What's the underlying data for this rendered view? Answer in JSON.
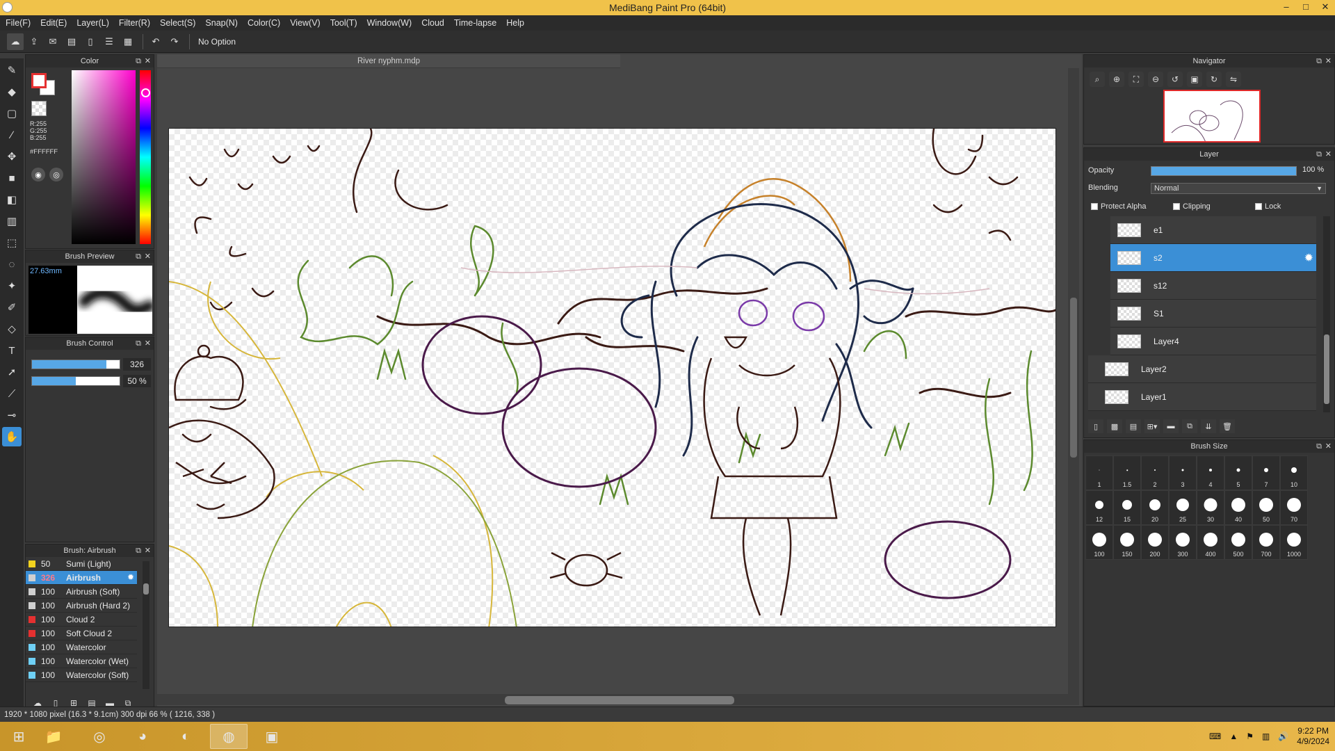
{
  "window": {
    "title": "MediBang Paint Pro (64bit)",
    "min": "–",
    "max": "□",
    "close": "✕"
  },
  "menu": [
    "File(F)",
    "Edit(E)",
    "Layer(L)",
    "Filter(R)",
    "Select(S)",
    "Snap(N)",
    "Color(C)",
    "View(V)",
    "Tool(T)",
    "Window(W)",
    "Cloud",
    "Time-lapse",
    "Help"
  ],
  "toolbar": {
    "option_text": "No Option"
  },
  "color_panel": {
    "title": "Color",
    "r": "R:255",
    "g": "G:255",
    "b": "B:255",
    "hex": "#FFFFFF",
    "fg_border": "#e53030"
  },
  "brush_preview": {
    "title": "Brush Preview",
    "size": "27.63mm"
  },
  "brush_control": {
    "title": "Brush Control",
    "size_value": "326",
    "size_fill": 0.85,
    "opacity_value": "50 %",
    "opacity_fill": 0.5
  },
  "brush_list": {
    "title": "Brush: Airbrush",
    "items": [
      {
        "size": "50",
        "name": "Sumi (Light)",
        "color": "#f2d21e"
      },
      {
        "size": "326",
        "name": "Airbrush",
        "color": "#d0d0d0",
        "selected": true
      },
      {
        "size": "100",
        "name": "Airbrush (Soft)",
        "color": "#d0d0d0"
      },
      {
        "size": "100",
        "name": "Airbrush (Hard 2)",
        "color": "#d0d0d0"
      },
      {
        "size": "100",
        "name": "Cloud 2",
        "color": "#e53030"
      },
      {
        "size": "100",
        "name": "Soft Cloud 2",
        "color": "#e53030"
      },
      {
        "size": "100",
        "name": "Watercolor",
        "color": "#6fd0f5"
      },
      {
        "size": "100",
        "name": "Watercolor (Wet)",
        "color": "#6fd0f5"
      },
      {
        "size": "100",
        "name": "Watercolor (Soft)",
        "color": "#6fd0f5"
      }
    ]
  },
  "document": {
    "tab": "River nyphm.mdp"
  },
  "navigator": {
    "title": "Navigator"
  },
  "layer_panel": {
    "title": "Layer",
    "opacity_label": "Opacity",
    "opacity_value": "100 %",
    "blending_label": "Blending",
    "blending_value": "Normal",
    "protect_alpha": "Protect Alpha",
    "clipping": "Clipping",
    "lock": "Lock",
    "layers": [
      {
        "name": "e1",
        "indent": true
      },
      {
        "name": "s2",
        "indent": true,
        "selected": true
      },
      {
        "name": "s12",
        "indent": true
      },
      {
        "name": "S1",
        "indent": true
      },
      {
        "name": "Layer4",
        "indent": true
      },
      {
        "name": "Layer2",
        "indent": false
      },
      {
        "name": "Layer1",
        "indent": false
      }
    ]
  },
  "brush_size": {
    "title": "Brush Size",
    "sizes": [
      "1",
      "1.5",
      "2",
      "3",
      "4",
      "5",
      "7",
      "10",
      "12",
      "15",
      "20",
      "25",
      "30",
      "40",
      "50",
      "70",
      "100",
      "150",
      "200",
      "300",
      "400",
      "500",
      "700",
      "1000"
    ]
  },
  "status": {
    "text": "1920 * 1080 pixel   (16.3 * 9.1cm)   300 dpi   66 %   ( 1216, 338 )"
  },
  "taskbar": {
    "time": "9:22 PM",
    "date": "4/9/2024"
  }
}
